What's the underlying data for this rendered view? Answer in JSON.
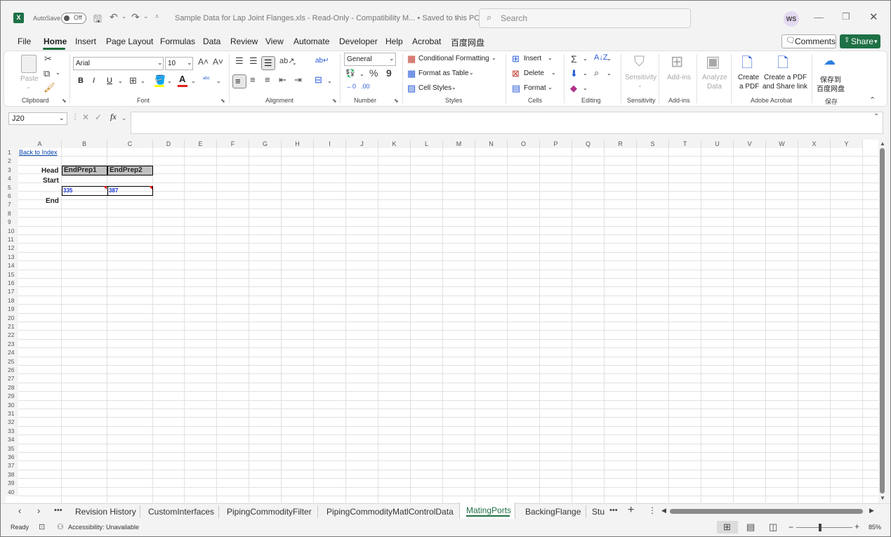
{
  "titlebar": {
    "autosave_label": "AutoSave",
    "autosave_state": "Off",
    "document_title": "Sample Data for Lap Joint Flanges.xls  -  Read-Only  -  Compatibility M...  •  Saved to this PC",
    "search_placeholder": "Search",
    "user_initials": "WS"
  },
  "menu": {
    "items": [
      "File",
      "Home",
      "Insert",
      "Page Layout",
      "Formulas",
      "Data",
      "Review",
      "View",
      "Automate",
      "Developer",
      "Help",
      "Acrobat",
      "百度网盘"
    ],
    "active": "Home",
    "comments_label": "Comments",
    "share_label": "Share"
  },
  "ribbon": {
    "clipboard": {
      "paste_label": "Paste",
      "group_label": "Clipboard"
    },
    "font": {
      "name": "Arial",
      "size": "10",
      "group_label": "Font",
      "bold": "B",
      "italic": "I",
      "underline": "U"
    },
    "alignment": {
      "group_label": "Alignment"
    },
    "number": {
      "format": "General",
      "group_label": "Number"
    },
    "styles": {
      "conditional": "Conditional Formatting",
      "format_table": "Format as Table",
      "cell_styles": "Cell Styles",
      "group_label": "Styles"
    },
    "cells": {
      "insert": "Insert",
      "delete": "Delete",
      "format": "Format",
      "group_label": "Cells"
    },
    "editing": {
      "group_label": "Editing"
    },
    "sensitivity": {
      "label": "Sensitivity",
      "group_label": "Sensitivity"
    },
    "addins": {
      "label": "Add-ins",
      "group_label": "Add-ins"
    },
    "analyze": {
      "label1": "Analyze",
      "label2": "Data"
    },
    "acrobat": {
      "create_pdf1": "Create",
      "create_pdf2": "a PDF",
      "share_pdf1": "Create a PDF",
      "share_pdf2": "and Share link",
      "group_label": "Adobe Acrobat"
    },
    "baidu": {
      "label1": "保存到",
      "label2": "百度网盘",
      "group_label": "保存"
    }
  },
  "formula_bar": {
    "name_box": "J20",
    "fx": "fx",
    "content": ""
  },
  "grid": {
    "columns": [
      "A",
      "B",
      "C",
      "D",
      "E",
      "F",
      "G",
      "H",
      "I",
      "J",
      "K",
      "L",
      "M",
      "N",
      "O",
      "P",
      "Q",
      "R",
      "S",
      "T",
      "U",
      "V",
      "W",
      "X",
      "Y"
    ],
    "rows": [
      "1",
      "2",
      "3",
      "4",
      "5",
      "6",
      "7",
      "8",
      "9",
      "10",
      "11",
      "12",
      "13",
      "14",
      "15",
      "16",
      "17",
      "18",
      "19",
      "20",
      "21",
      "22",
      "23",
      "24",
      "25",
      "26",
      "27",
      "28",
      "29",
      "30",
      "31",
      "32",
      "33",
      "34",
      "35",
      "36",
      "37",
      "38",
      "39",
      "40"
    ],
    "cells": {
      "A1": "Back to Index",
      "A3": "Head",
      "A4": "Start",
      "A6": "End",
      "B3": "EndPrep1",
      "C3": "EndPrep2",
      "B5": "335",
      "C5": "387"
    }
  },
  "sheet_tabs": {
    "tabs": [
      "Revision History",
      "CustomInterfaces",
      "PipingCommodityFilter",
      "PipingCommodityMatlControlData",
      "MatingPorts",
      "BackingFlange",
      "Stu"
    ],
    "active": "MatingPorts"
  },
  "status": {
    "ready": "Ready",
    "accessibility": "Accessibility: Unavailable",
    "zoom": "85%"
  }
}
